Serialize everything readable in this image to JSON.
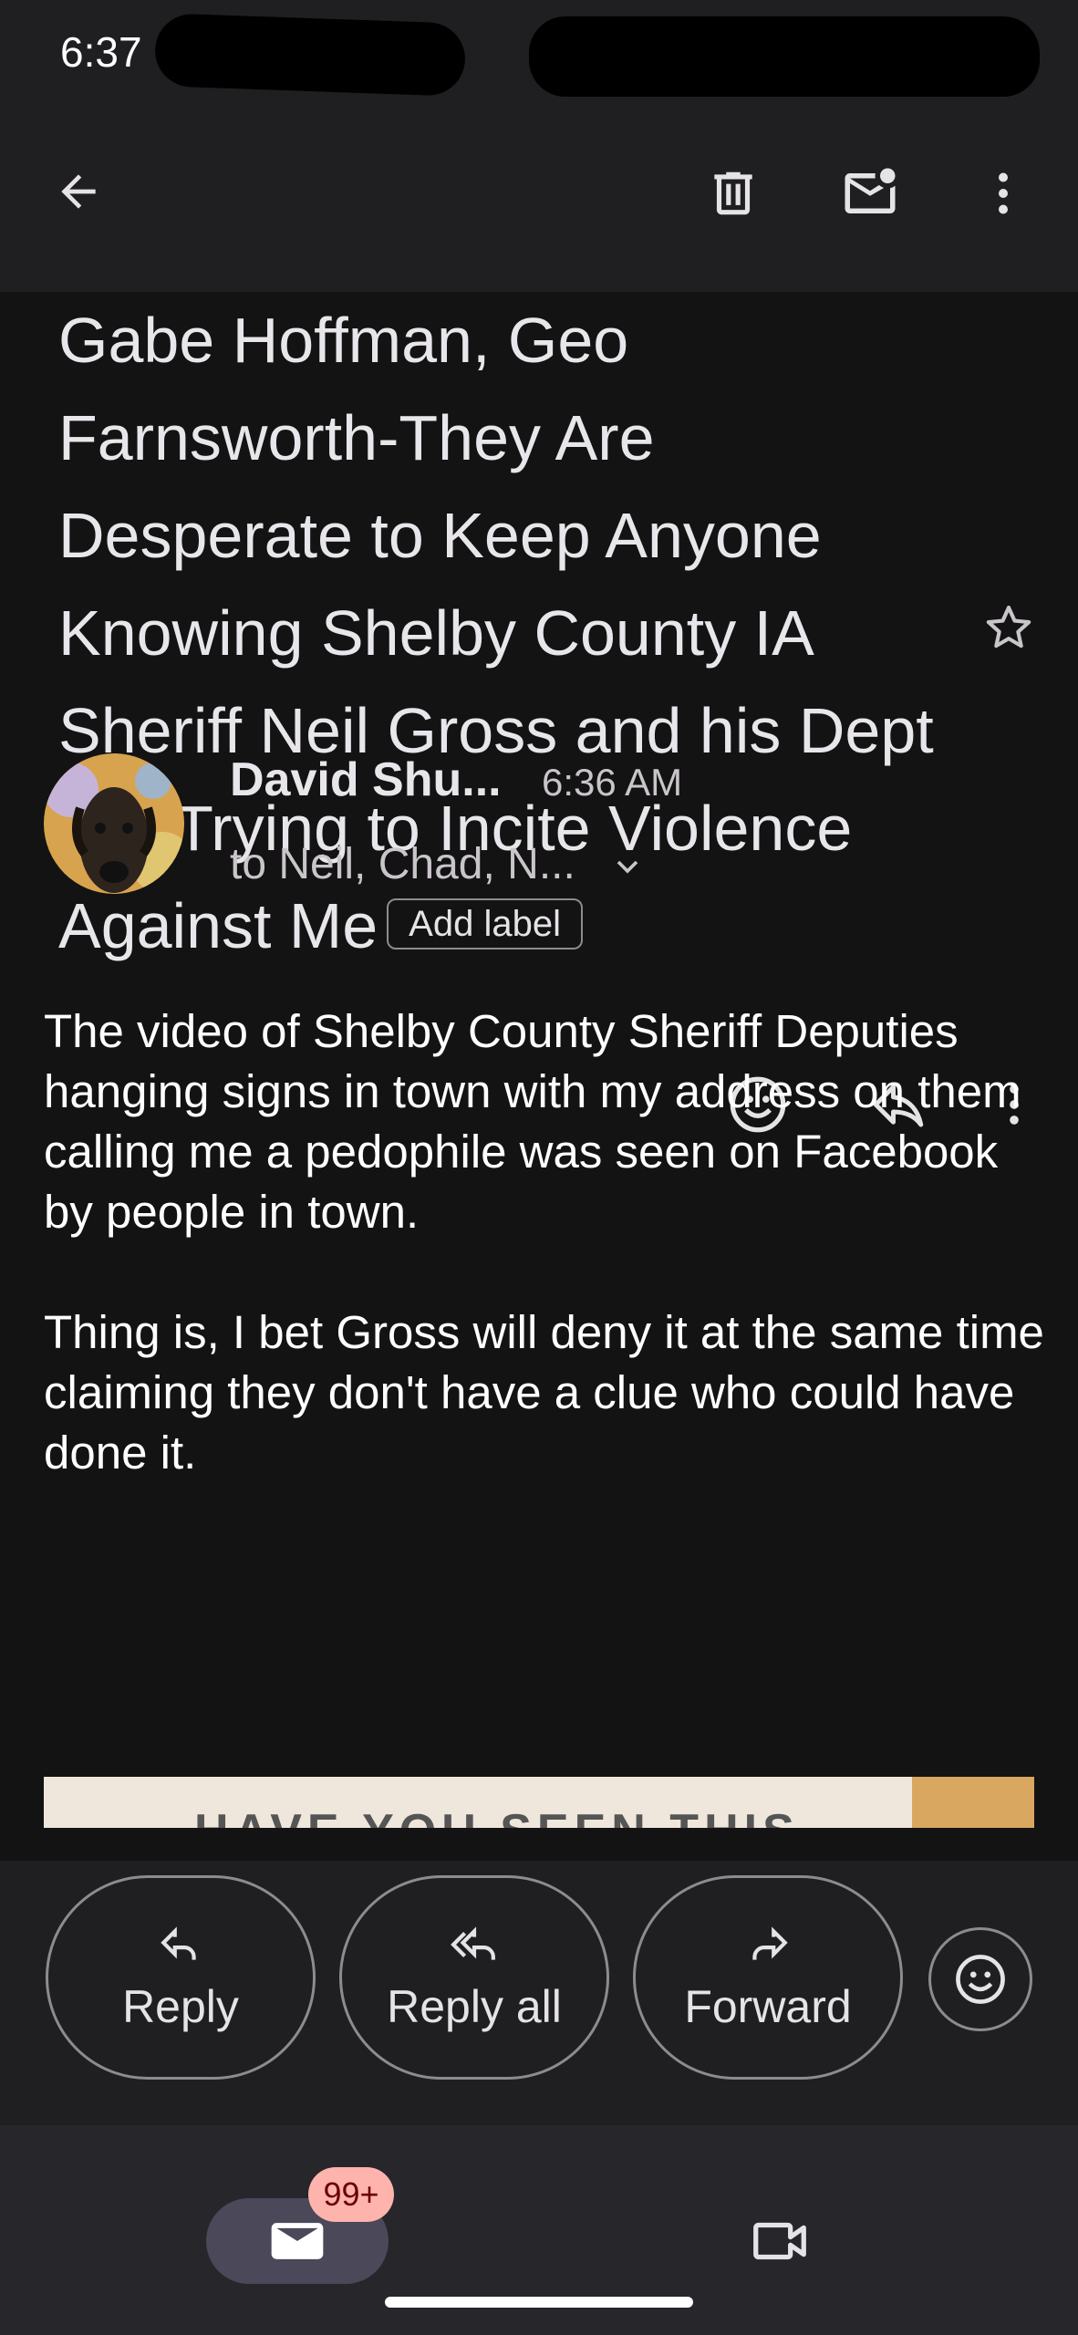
{
  "status_bar": {
    "time": "6:37"
  },
  "app_bar": {
    "back_icon": "arrow-left-icon",
    "delete_icon": "trash-icon",
    "mark_unread_icon": "mail-unread-icon",
    "more_icon": "more-vert-icon"
  },
  "email": {
    "subject": "Gabe Hoffman, Geo Farnsworth-They Are Desperate to Keep Anyone Knowing Shelby County IA Sheriff Neil Gross and his Dept Are Trying to Incite Violence Against Me",
    "add_label": "Add label",
    "sender": "David Shu...",
    "time": "6:36 AM",
    "recipients": "to Neil, Chad, N...",
    "body": [
      "The video of Shelby County Sheriff Deputies hanging signs in town with my address on them calling me a pedophile was seen on Facebook by people in town.",
      "Thing is, I bet Gross will deny it at the same time claiming they don't have a clue who could have done it."
    ],
    "attachment_text": "HAVE YOU SEEN THIS"
  },
  "actions": {
    "reply": "Reply",
    "reply_all": "Reply all",
    "forward": "Forward"
  },
  "bottom_nav": {
    "mail_badge": "99+"
  },
  "colors": {
    "background": "#131313",
    "bar": "#1f1f22",
    "nav": "#26262b",
    "badge": "#ffb3ad",
    "active_tab": "#4a4859"
  }
}
